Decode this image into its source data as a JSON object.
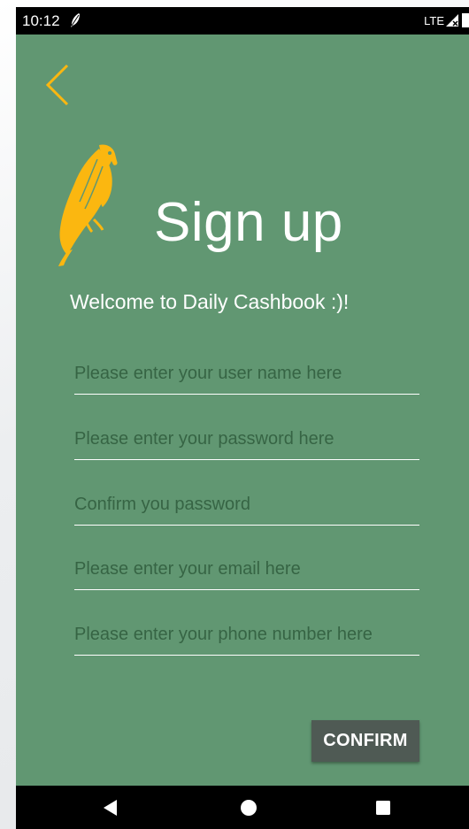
{
  "status_bar": {
    "time": "10:12",
    "network": "LTE"
  },
  "header": {
    "title": "Sign up",
    "welcome": "Welcome to Daily Cashbook :)!"
  },
  "form": {
    "username_placeholder": "Please enter your user name here",
    "password_placeholder": "Please enter your password here",
    "confirm_password_placeholder": "Confirm you password",
    "email_placeholder": "Please enter your email here",
    "phone_placeholder": "Please enter your phone number here",
    "confirm_label": "CONFIRM"
  },
  "colors": {
    "background": "#619772",
    "accent": "#fbb710",
    "button": "#4f5a54"
  },
  "icons": {
    "back": "chevron-left-icon",
    "logo": "parrot-logo",
    "nav_back": "triangle-back-icon",
    "nav_home": "circle-home-icon",
    "nav_recent": "square-recent-icon"
  }
}
